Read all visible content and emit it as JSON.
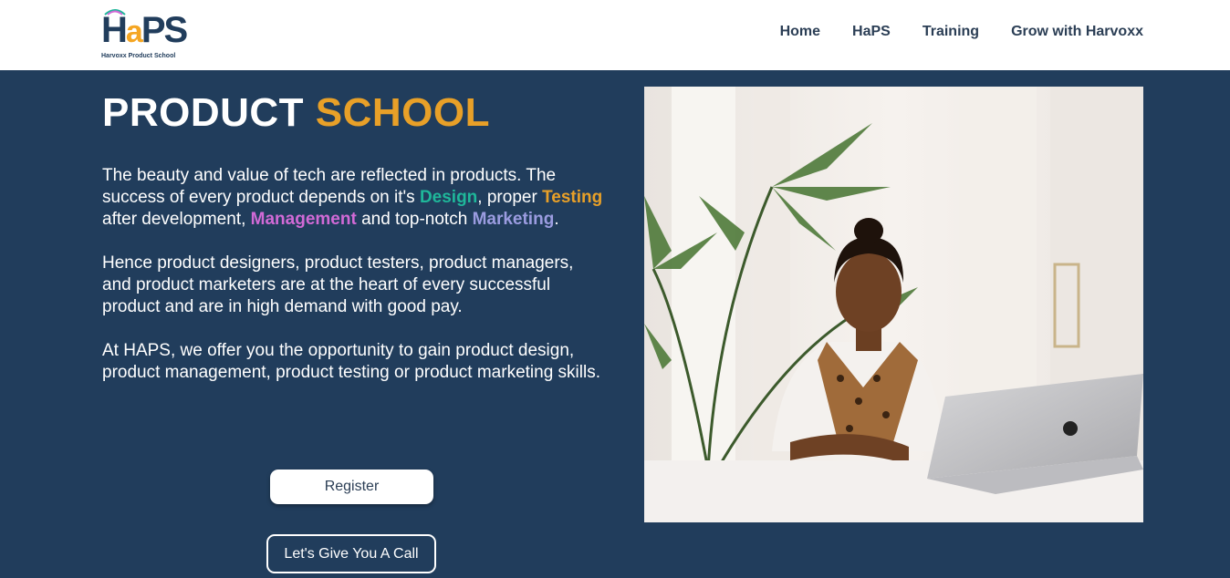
{
  "brand": {
    "logo_text_h": "H",
    "logo_text_a": "a",
    "logo_text_ps": "PS",
    "logo_tagline": "Harvoxx Product School"
  },
  "nav": {
    "items": [
      {
        "label": "Home"
      },
      {
        "label": "HaPS"
      },
      {
        "label": "Training"
      },
      {
        "label": "Grow with Harvoxx"
      }
    ]
  },
  "hero": {
    "title_main": "PRODUCT ",
    "title_accent": "SCHOOL",
    "paragraph1": {
      "t1": "The beauty and value of tech are reflected in products. The success of every product depends on it's ",
      "design": "Design",
      "t2": ", proper ",
      "testing": "Testing",
      "t3": " after development, ",
      "management": "Management",
      "t4": " and top-notch ",
      "marketing": "Marketing",
      "t5": "."
    },
    "paragraph2": "Hence product designers, product testers, product managers, and product marketers are at the heart of every successful product and are in high demand with good pay.",
    "paragraph3": "At HAPS, we offer you the opportunity to gain product design, product management, product testing or product marketing skills.",
    "register_label": "Register",
    "call_label": "Let's Give You A Call"
  },
  "colors": {
    "background": "#213d5c",
    "accent_orange": "#e8a028",
    "design_green": "#1fb79a",
    "management_pink": "#d16ad6",
    "marketing_lavender": "#9b9ce0"
  }
}
